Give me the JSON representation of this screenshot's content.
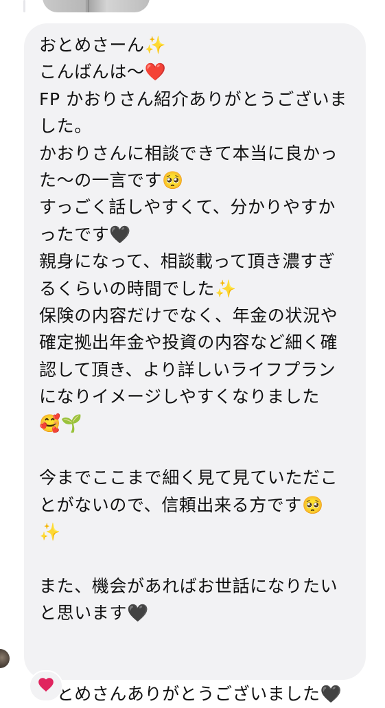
{
  "message": {
    "lines": [
      "おとめさーん✨",
      "こんばんは〜❤️",
      "FP かおりさん紹介ありがとうございま",
      "した。",
      "かおりさんに相談できて本当に良かっ",
      "た〜の一言です🥺",
      "すっごく話しやすくて、分かりやすか",
      "ったです🖤",
      "親身になって、相談載って頂き濃すぎ",
      "るくらいの時間でした✨",
      "保険の内容だけでなく、年金の状況や",
      "確定拠出年金や投資の内容など細く確",
      "認して頂き、より詳しいライフプラン",
      "になりイメージしやすくなりました",
      "🥰🌱",
      "",
      "今までここまで細く見て見ていただこ",
      "とがないので、信頼出来る方です🥺",
      "✨",
      "",
      "また、機会があればお世話になりたい",
      "と思います🖤",
      "",
      "",
      "おとめさんありがとうございました🖤"
    ]
  },
  "reaction": {
    "icon": "red-heart-icon",
    "color": "#e0245e"
  }
}
